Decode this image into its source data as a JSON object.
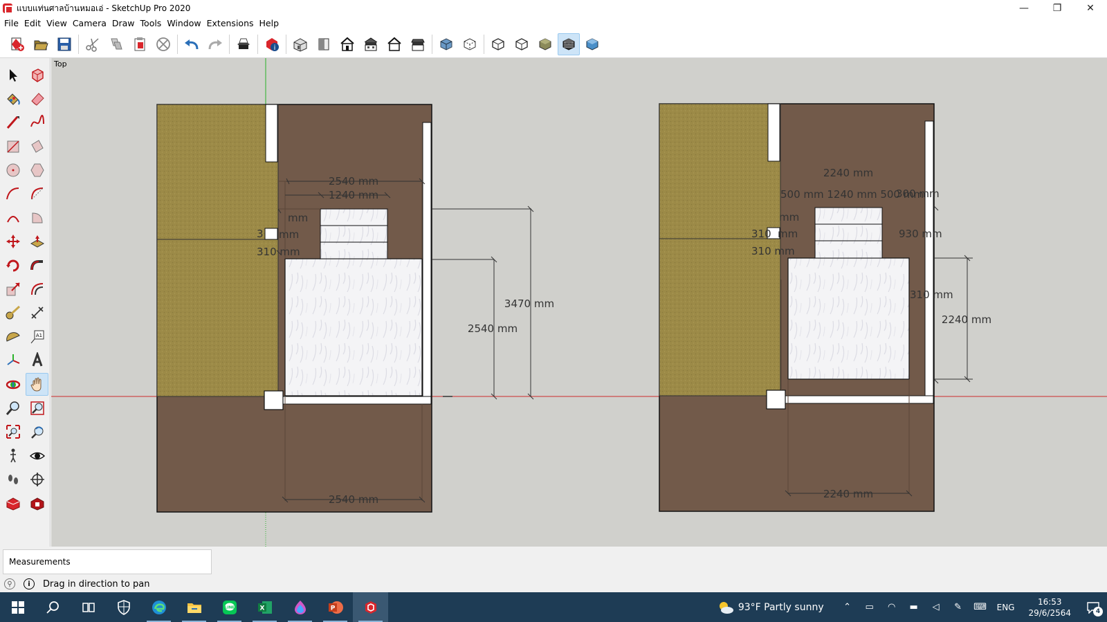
{
  "window": {
    "title": "แบบแท่นศาลบ้านหมอเอ่ - SketchUp Pro 2020",
    "controls": {
      "minimize": "—",
      "maximize": "❐",
      "close": "✕"
    }
  },
  "menu": [
    "File",
    "Edit",
    "View",
    "Camera",
    "Draw",
    "Tools",
    "Window",
    "Extensions",
    "Help"
  ],
  "toolbar": {
    "groups": [
      [
        "new-icon",
        "open-icon",
        "save-icon"
      ],
      [
        "cut-icon",
        "copy-icon",
        "paste-icon",
        "erase-circle-icon"
      ],
      [
        "undo-icon",
        "redo-icon"
      ],
      [
        "print-icon"
      ],
      [
        "model-info-icon"
      ],
      [
        "iso-view-icon",
        "top-view-icon",
        "front-view-icon",
        "right-view-icon",
        "back-view-icon",
        "left-view-icon"
      ],
      [
        "xray-icon",
        "back-edges-icon"
      ],
      [
        "wireframe-icon",
        "hidden-line-icon",
        "shaded-icon",
        "shaded-textures-icon",
        "monochrome-icon"
      ]
    ],
    "active": "shaded-textures-icon"
  },
  "palette": {
    "tools": [
      "select-icon",
      "make-component-icon",
      "paint-bucket-icon",
      "eraser-icon",
      "line-icon",
      "freehand-icon",
      "rectangle-icon",
      "rotated-rectangle-icon",
      "circle-icon",
      "polygon-icon",
      "arc-icon",
      "two-point-arc-icon",
      "three-point-arc-icon",
      "pie-icon",
      "move-icon",
      "push-pull-icon",
      "rotate-icon",
      "follow-me-icon",
      "scale-icon",
      "offset-icon",
      "tape-measure-icon",
      "dimension-icon",
      "protractor-icon",
      "text-icon",
      "axes-icon",
      "3d-text-icon",
      "orbit-icon",
      "pan-icon",
      "zoom-icon",
      "zoom-window-icon",
      "zoom-extents-icon",
      "previous-view-icon",
      "position-camera-icon",
      "look-around-icon",
      "walk-icon",
      "section-plane-icon",
      "warehouse-icon",
      "extension-warehouse-icon"
    ],
    "active": "pan-icon"
  },
  "viewport": {
    "scene_label": "Top",
    "dimensions_left": {
      "top_width": "2540 mm",
      "inner_width": "1240 mm",
      "small_mm": "mm",
      "side_a": "3",
      "side_a_mm": "mm",
      "side_b": "310 mm",
      "height_total": "3470 mm",
      "height_body": "2540 mm",
      "bottom_width": "2540 mm"
    },
    "dimensions_right": {
      "top_width": "2240 mm",
      "segment_row": "500 mm 1240 mm 500 mm",
      "segment_extra": "300 mm",
      "small_mm": "mm",
      "side_a": "310",
      "side_a_mm": "mm",
      "side_b": "310 mm",
      "right_930": "930 mm",
      "right_310": "310 mm",
      "height_body": "2240 mm",
      "bottom_width": "2240 mm"
    }
  },
  "measurements": {
    "label": "Measurements",
    "value": ""
  },
  "status": {
    "text": "Drag in direction to pan",
    "info_glyph": "i",
    "geo_glyph": "⚲"
  },
  "taskbar": {
    "apps": [
      "start-icon",
      "search-icon",
      "task-view-icon",
      "security-icon",
      "edge-icon",
      "explorer-icon",
      "line-app-icon",
      "excel-icon",
      "color-app-icon",
      "powerpoint-icon",
      "sketchup-icon"
    ],
    "active": "sketchup-icon",
    "weather": "93°F  Partly sunny",
    "lang": "ENG",
    "time": "16:53",
    "date": "29/6/2564",
    "notif_count": "4"
  },
  "colors": {
    "viewport_bg": "#d0d0cc",
    "dark_brown": "#725a4a",
    "olive": "#9c8a47",
    "taskbar": "#1e3c55",
    "axis_green": "#29b229",
    "axis_red": "#cc2b2b"
  }
}
